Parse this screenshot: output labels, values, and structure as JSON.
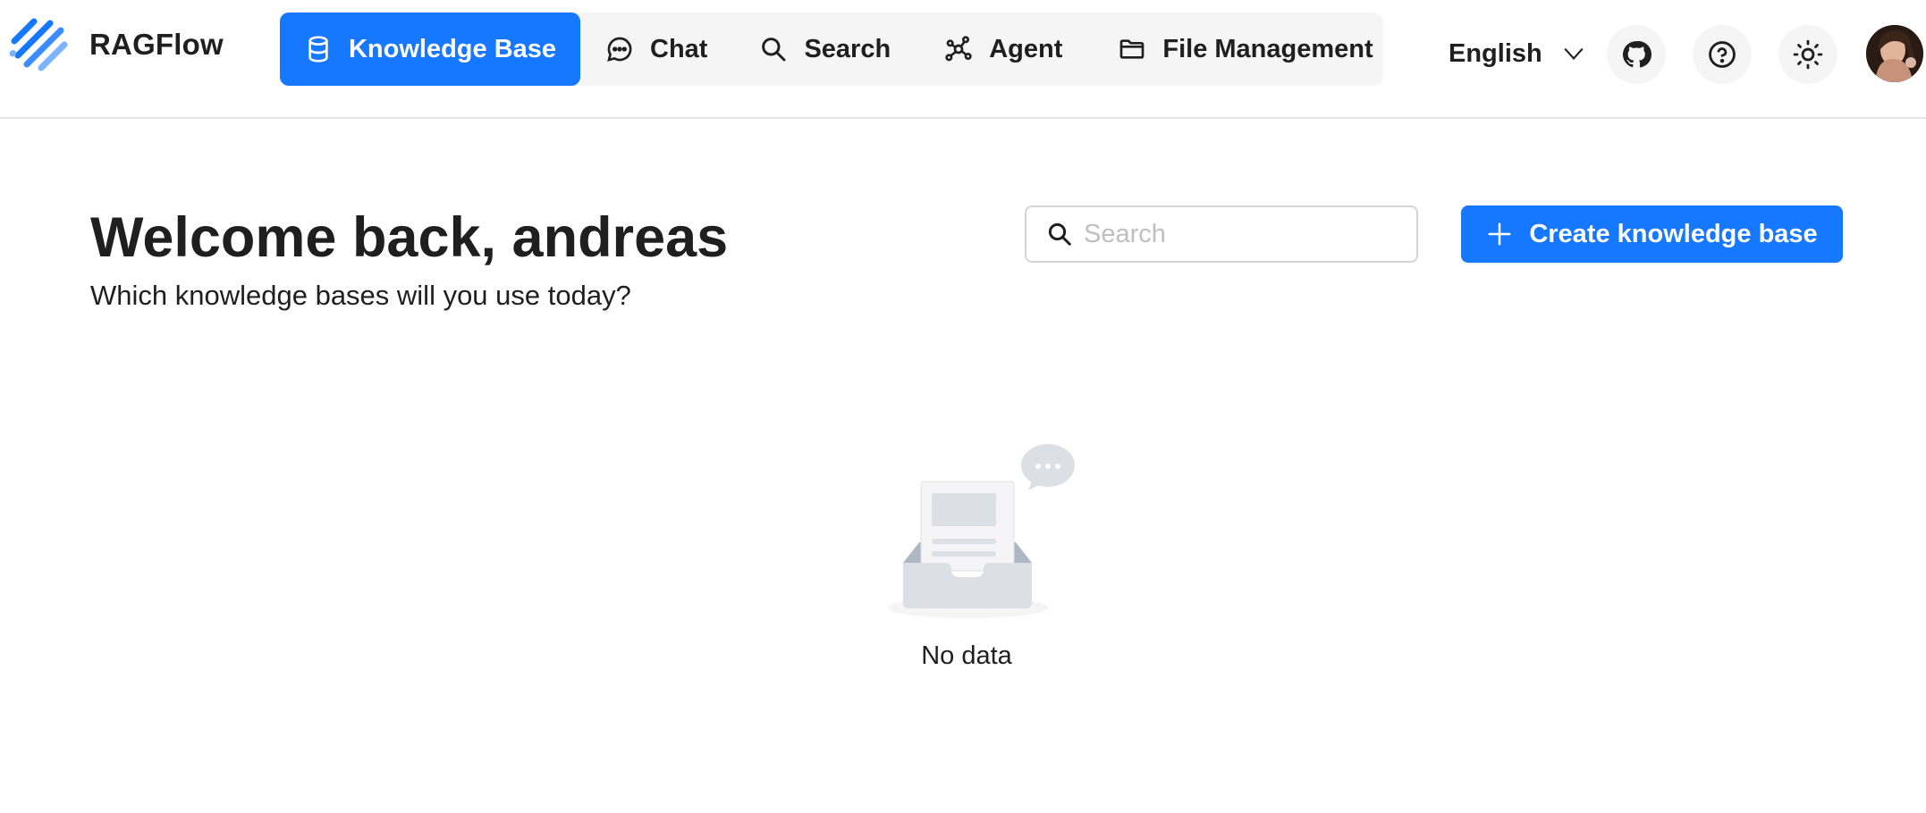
{
  "app": {
    "name": "RAGFlow"
  },
  "nav": {
    "items": [
      {
        "label": "Knowledge Base",
        "icon": "database-icon",
        "active": true
      },
      {
        "label": "Chat",
        "icon": "chat-bubble-icon",
        "active": false
      },
      {
        "label": "Search",
        "icon": "search-icon",
        "active": false
      },
      {
        "label": "Agent",
        "icon": "agent-graph-icon",
        "active": false
      },
      {
        "label": "File Management",
        "icon": "folder-icon",
        "active": false
      }
    ]
  },
  "header": {
    "language": "English",
    "github_icon": "github-icon",
    "help_icon": "help-circle-icon",
    "theme_icon": "sun-icon"
  },
  "main": {
    "welcome": "Welcome back, andreas",
    "subtitle": "Which knowledge bases will you use today?",
    "search_placeholder": "Search",
    "create_label": "Create knowledge base",
    "empty_text": "No data"
  },
  "colors": {
    "accent": "#1677ff",
    "nav_background": "#f5f5f5",
    "text": "#1f1f1f"
  }
}
